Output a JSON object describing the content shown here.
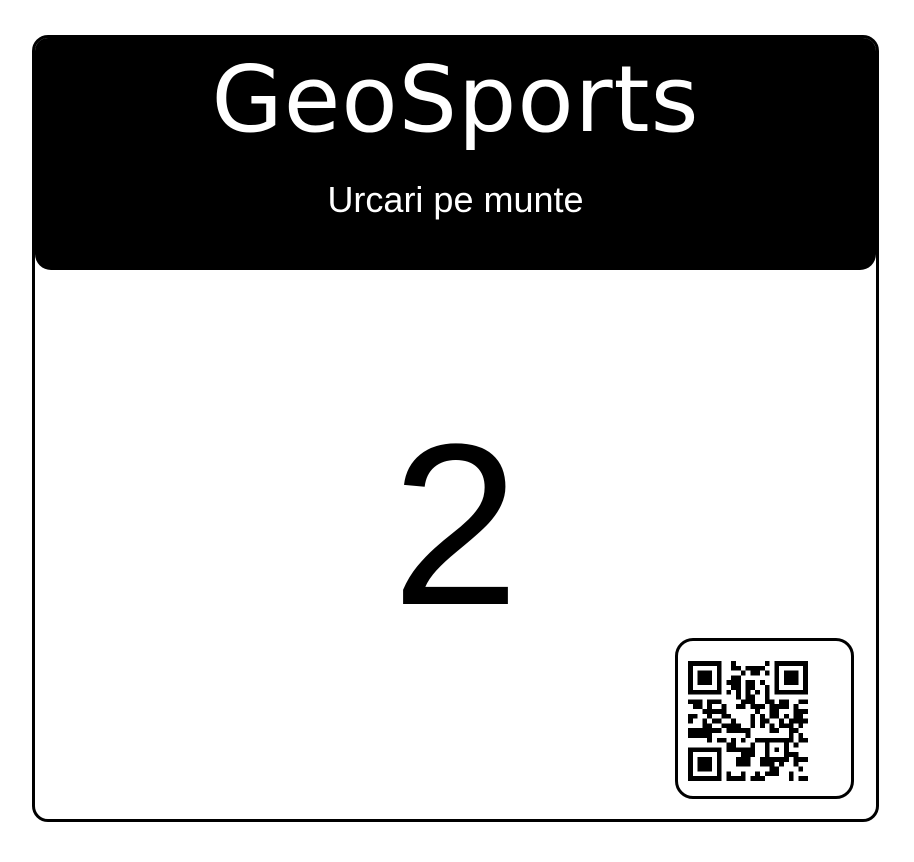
{
  "header": {
    "brand": "GeoSports",
    "subtitle": "Urcari pe munte"
  },
  "bib": {
    "number": "2"
  },
  "qr": {
    "icon": "qr-code-icon"
  },
  "colors": {
    "ink": "#000000",
    "paper": "#ffffff"
  }
}
